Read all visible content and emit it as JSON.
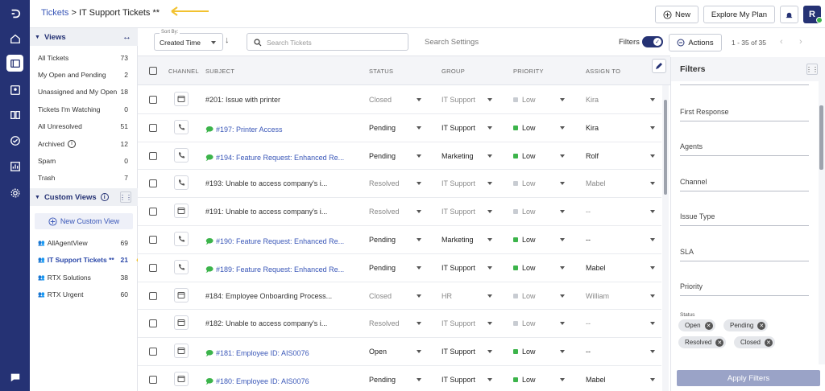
{
  "header": {
    "breadcrumb_link": "Tickets",
    "breadcrumb_sep": " > ",
    "breadcrumb_current": "IT Support Tickets **",
    "new_label": "New",
    "explore_label": "Explore My Plan",
    "avatar_letter": "R"
  },
  "sidebar": {
    "views_title": "Views",
    "views": [
      {
        "label": "All Tickets",
        "count": "73"
      },
      {
        "label": "My Open and Pending",
        "count": "2"
      },
      {
        "label": "Unassigned and My Open",
        "count": "18"
      },
      {
        "label": "Tickets I'm Watching",
        "count": "0"
      },
      {
        "label": "All Unresolved",
        "count": "51"
      },
      {
        "label": "Archived",
        "count": "12"
      },
      {
        "label": "Spam",
        "count": "0"
      },
      {
        "label": "Trash",
        "count": "7"
      }
    ],
    "custom_title": "Custom Views",
    "new_custom_label": "New Custom View",
    "custom_views": [
      {
        "label": "AllAgentView",
        "count": "69"
      },
      {
        "label": "IT Support Tickets **",
        "count": "21"
      },
      {
        "label": "RTX Solutions",
        "count": "38"
      },
      {
        "label": "RTX Urgent",
        "count": "60"
      }
    ]
  },
  "toolbar": {
    "sort_label": "Sort By:",
    "sort_value": "Created Time",
    "search_placeholder": "Search Tickets",
    "search_settings": "Search Settings",
    "filters_label": "Filters",
    "actions_label": "Actions",
    "pagination": "1 - 35 of 35"
  },
  "table": {
    "headers": {
      "channel": "CHANNEL",
      "subject": "SUBJECT",
      "status": "STATUS",
      "group": "GROUP",
      "priority": "PRIORITY",
      "assign": "ASSIGN TO"
    },
    "rows": [
      {
        "channel": "email",
        "chat": false,
        "subject": "#201: Issue with printer",
        "status": "Closed",
        "group": "IT Support",
        "priority": "Low",
        "assign": "Kira",
        "muted": true
      },
      {
        "channel": "phone",
        "chat": true,
        "subject": "#197: Printer Access",
        "status": "Pending",
        "group": "IT Support",
        "priority": "Low",
        "assign": "Kira",
        "muted": false
      },
      {
        "channel": "phone",
        "chat": true,
        "subject": "#194: Feature Request: Enhanced Re...",
        "status": "Pending",
        "group": "Marketing",
        "priority": "Low",
        "assign": "Rolf",
        "muted": false
      },
      {
        "channel": "phone",
        "chat": false,
        "subject": "#193: Unable to access company's i...",
        "status": "Resolved",
        "group": "IT Support",
        "priority": "Low",
        "assign": "Mabel",
        "muted": true
      },
      {
        "channel": "email",
        "chat": false,
        "subject": "#191: Unable to access company's i...",
        "status": "Resolved",
        "group": "IT Support",
        "priority": "Low",
        "assign": "--",
        "muted": true
      },
      {
        "channel": "phone",
        "chat": true,
        "subject": "#190: Feature Request: Enhanced Re...",
        "status": "Pending",
        "group": "Marketing",
        "priority": "Low",
        "assign": "--",
        "muted": false
      },
      {
        "channel": "phone",
        "chat": true,
        "subject": "#189: Feature Request: Enhanced Re...",
        "status": "Pending",
        "group": "IT Support",
        "priority": "Low",
        "assign": "Mabel",
        "muted": false
      },
      {
        "channel": "email",
        "chat": false,
        "subject": "#184: Employee Onboarding Process...",
        "status": "Closed",
        "group": "HR",
        "priority": "Low",
        "assign": "William",
        "muted": true
      },
      {
        "channel": "email",
        "chat": false,
        "subject": "#182: Unable to access company's i...",
        "status": "Resolved",
        "group": "IT Support",
        "priority": "Low",
        "assign": "--",
        "muted": true
      },
      {
        "channel": "email",
        "chat": true,
        "subject": "#181: Employee ID: AIS0076",
        "status": "Open",
        "group": "IT Support",
        "priority": "Low",
        "assign": "--",
        "muted": false
      },
      {
        "channel": "email",
        "chat": true,
        "subject": "#180: Employee ID: AIS0076",
        "status": "Pending",
        "group": "IT Support",
        "priority": "Low",
        "assign": "Mabel",
        "muted": false
      }
    ]
  },
  "filters_panel": {
    "title": "Filters",
    "fields": [
      "First Response",
      "Agents",
      "Channel",
      "Issue Type",
      "SLA",
      "Priority"
    ],
    "status_label": "Status",
    "status_chips": [
      "Open",
      "Pending",
      "Resolved",
      "Closed"
    ],
    "apply_label": "Apply Filters"
  },
  "colors": {
    "rail": "#253274",
    "accent": "#3a57b8",
    "priority_low_active": "#3cb44b",
    "priority_low_muted": "#c8ccd2",
    "annotation": "#f2c230"
  }
}
